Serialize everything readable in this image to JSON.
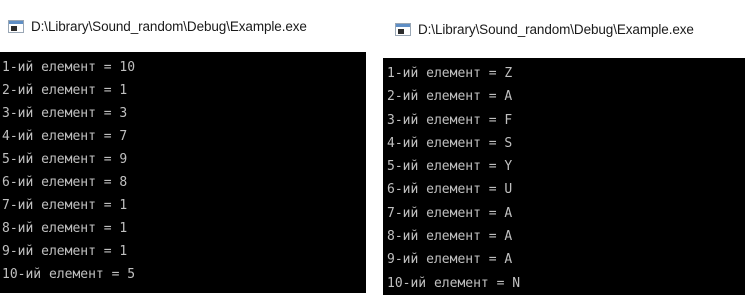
{
  "left_window": {
    "title": "D:\\Library\\Sound_random\\Debug\\Example.exe",
    "icon": "console-app-icon",
    "lines": [
      "1-ий елемент = 10",
      "2-ий елемент = 1",
      "3-ий елемент = 3",
      "4-ий елемент = 7",
      "5-ий елемент = 9",
      "6-ий елемент = 8",
      "7-ий елемент = 1",
      "8-ий елемент = 1",
      "9-ий елемент = 1",
      "10-ий елемент = 5"
    ]
  },
  "right_window": {
    "title": "D:\\Library\\Sound_random\\Debug\\Example.exe",
    "icon": "console-app-icon",
    "lines": [
      "1-ий елемент = Z",
      "2-ий елемент = A",
      "3-ий елемент = F",
      "4-ий елемент = S",
      "5-ий елемент = Y",
      "6-ий елемент = U",
      "7-ий елемент = A",
      "8-ий елемент = A",
      "9-ий елемент = A",
      "10-ий елемент = N"
    ]
  },
  "colors": {
    "console_background": "#000000",
    "console_text": "#c0c0c0",
    "titlebar_background": "#ffffff",
    "title_text": "#1a1a1a"
  }
}
